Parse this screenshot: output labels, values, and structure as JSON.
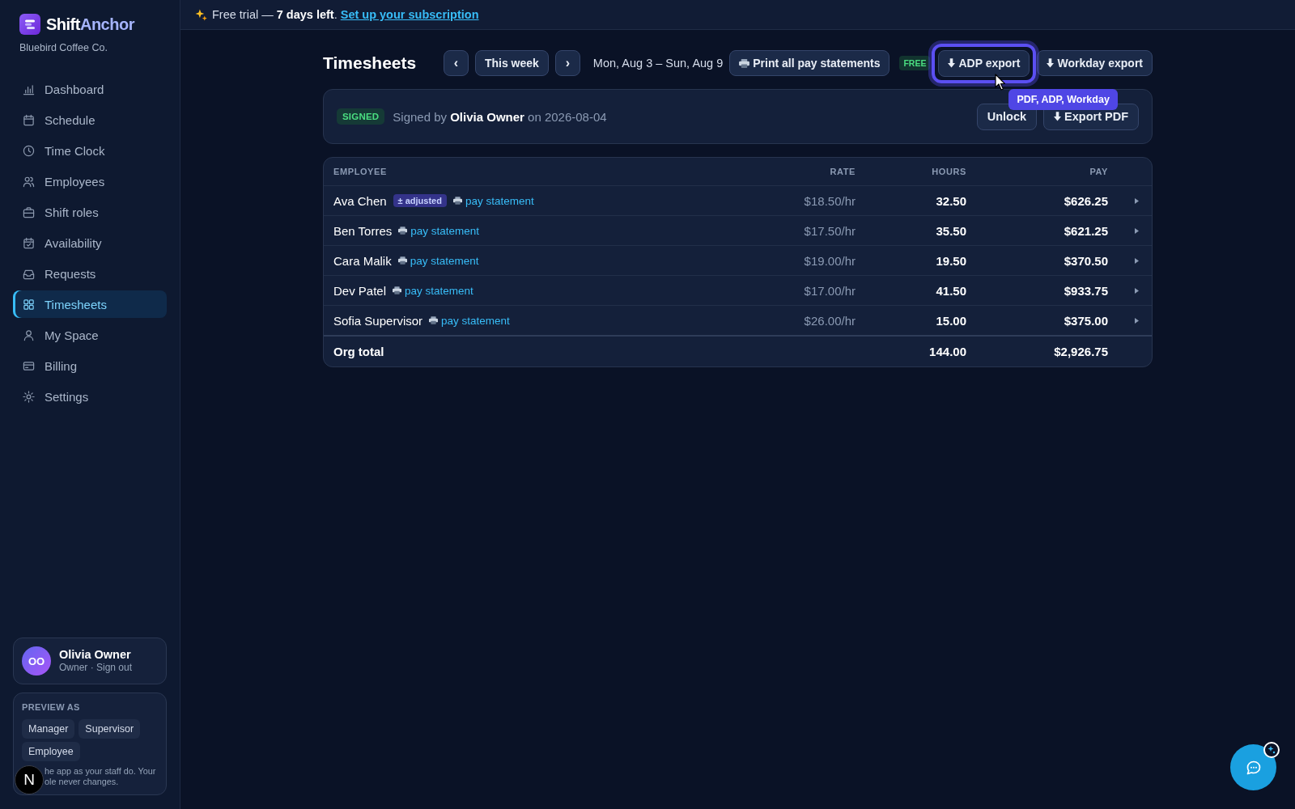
{
  "sidebar": {
    "brand": {
      "name": "Shift",
      "name_accent": "Anchor"
    },
    "organization": "Bluebird Coffee Co.",
    "nav": [
      {
        "label": "Dashboard",
        "selected": false
      },
      {
        "label": "Schedule",
        "selected": false
      },
      {
        "label": "Time Clock",
        "selected": false
      },
      {
        "label": "Employees",
        "selected": false
      },
      {
        "label": "Shift roles",
        "selected": false
      },
      {
        "label": "Availability",
        "selected": false
      },
      {
        "label": "Requests",
        "selected": false
      },
      {
        "label": "Timesheets",
        "selected": true
      },
      {
        "label": "My Space",
        "selected": false
      },
      {
        "label": "Billing",
        "selected": false
      },
      {
        "label": "Settings",
        "selected": false
      }
    ],
    "user": {
      "initials": "OO",
      "name": "Olivia Owner",
      "role": "Owner · Sign out"
    },
    "preview": {
      "title": "PREVIEW AS",
      "roles": [
        "Manager",
        "Supervisor",
        "Employee"
      ],
      "note": [
        "he app as your staff do. Your",
        "ole never changes."
      ]
    },
    "dev_badge": "N"
  },
  "trial_banner": {
    "message": "Free trial — **7 days left**.",
    "link": "Set up your subscription"
  },
  "header": {
    "title": "Timesheets",
    "previous": "‹",
    "current": "This week",
    "next": "›",
    "range": "Mon, Aug 3 – Sun, Aug 9",
    "print_button": "Print all pay statements",
    "plan_badge": "FREE",
    "exports": [
      {
        "label": "ADP export",
        "focused": true
      },
      {
        "label": "Workday export",
        "focused": false
      }
    ],
    "tooltip": "PDF, ADP, Workday"
  },
  "signoff": {
    "status": "SIGNED",
    "message": "Signed by **Olivia Owner** on 2026-08-04",
    "buttons": [
      {
        "label": "Unlock",
        "kind": "plain"
      },
      {
        "label": "Export PDF",
        "kind": "download"
      }
    ]
  },
  "table": {
    "columns": [
      "EMPLOYEE",
      "RATE",
      "HOURS",
      "PAY"
    ],
    "rows": [
      {
        "name": "Ava Chen",
        "tag": "± adjusted",
        "link": "pay statement",
        "rate": "$18.50/hr",
        "hours": "32.50",
        "pay": "$626.25"
      },
      {
        "name": "Ben Torres",
        "link": "pay statement",
        "rate": "$17.50/hr",
        "hours": "35.50",
        "pay": "$621.25"
      },
      {
        "name": "Cara Malik",
        "link": "pay statement",
        "rate": "$19.00/hr",
        "hours": "19.50",
        "pay": "$370.50"
      },
      {
        "name": "Dev Patel",
        "link": "pay statement",
        "rate": "$17.00/hr",
        "hours": "41.50",
        "pay": "$933.75"
      },
      {
        "name": "Sofia Supervisor",
        "link": "pay statement",
        "rate": "$26.00/hr",
        "hours": "15.00",
        "pay": "$375.00"
      }
    ],
    "total": {
      "label": "Org total",
      "hours": "144.00",
      "pay": "$2,926.75"
    }
  }
}
